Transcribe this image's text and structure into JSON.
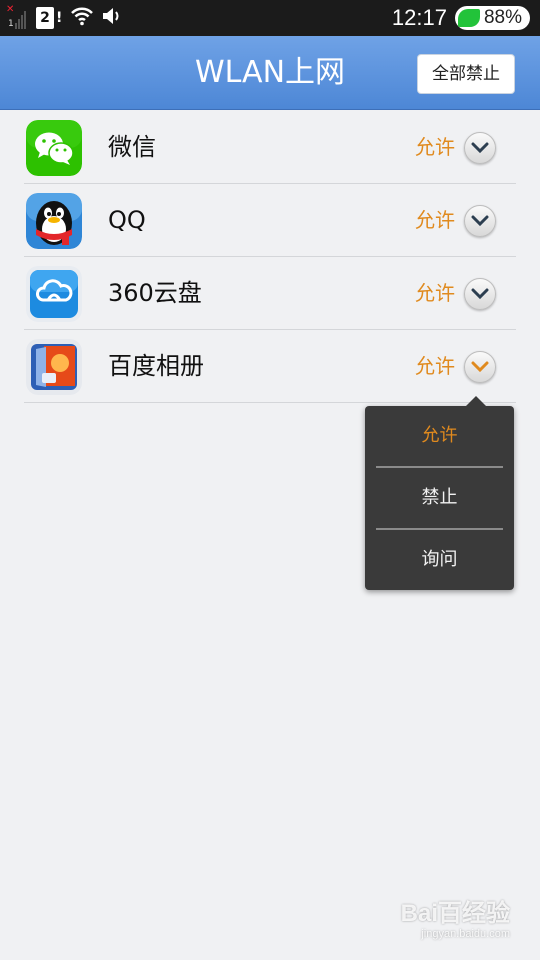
{
  "status_bar": {
    "sim_slot": "2",
    "sim_alert": "!",
    "signal_slot": "1",
    "time": "12:17",
    "battery": "88%",
    "icons": [
      "no-signal-icon",
      "sim-card-icon",
      "wifi-icon",
      "speaker-icon",
      "battery-leaf-icon"
    ]
  },
  "header": {
    "title": "WLAN上网",
    "ban_all_label": "全部禁止"
  },
  "apps": [
    {
      "name": "微信",
      "permission": "允许",
      "icon": "wechat-icon"
    },
    {
      "name": "QQ",
      "permission": "允许",
      "icon": "qq-icon"
    },
    {
      "name": "360云盘",
      "permission": "允许",
      "icon": "360-cloud-icon"
    },
    {
      "name": "百度相册",
      "permission": "允许",
      "icon": "baidu-album-icon",
      "expanded": true
    }
  ],
  "menu": {
    "options": [
      "允许",
      "禁止",
      "询问"
    ],
    "selected": "允许"
  },
  "colors": {
    "header": "#5b92dd",
    "accent_orange": "#e08a1e",
    "menu_bg": "#3a3a3a",
    "background": "#f0f1f3"
  },
  "watermark": {
    "main": "Bai百经验",
    "sub": "jingyan.baidu.com"
  }
}
